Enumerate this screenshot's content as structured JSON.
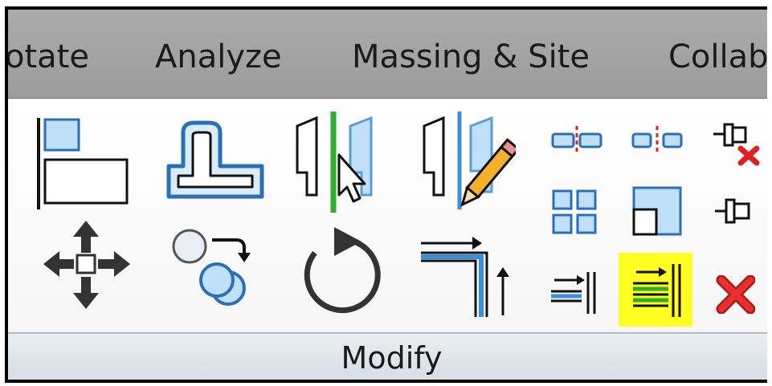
{
  "tabs": [
    {
      "label": "otate"
    },
    {
      "label": "Analyze"
    },
    {
      "label": "Massing & Site"
    },
    {
      "label": "Collab"
    }
  ],
  "panel": {
    "label": "Modify",
    "tools": [
      {
        "name": "align-icon"
      },
      {
        "name": "offset-icon"
      },
      {
        "name": "mirror-pick-axis-icon"
      },
      {
        "name": "mirror-draw-axis-icon"
      },
      {
        "name": "split-element-icon"
      },
      {
        "name": "split-with-gap-icon"
      },
      {
        "name": "unpin-icon"
      },
      {
        "name": "array-icon"
      },
      {
        "name": "scale-icon"
      },
      {
        "name": "pin-icon"
      },
      {
        "name": "move-icon"
      },
      {
        "name": "copy-icon"
      },
      {
        "name": "rotate-icon"
      },
      {
        "name": "trim-extend-to-corner-icon"
      },
      {
        "name": "trim-extend-single-element-icon"
      },
      {
        "name": "trim-extend-multiple-elements-icon",
        "highlighted": true
      },
      {
        "name": "delete-icon"
      }
    ]
  },
  "colors": {
    "highlight": "#ffff22",
    "accent_blue": "#3a8fd8",
    "delete_red": "#e02020",
    "mirror_green": "#2fae2f"
  }
}
